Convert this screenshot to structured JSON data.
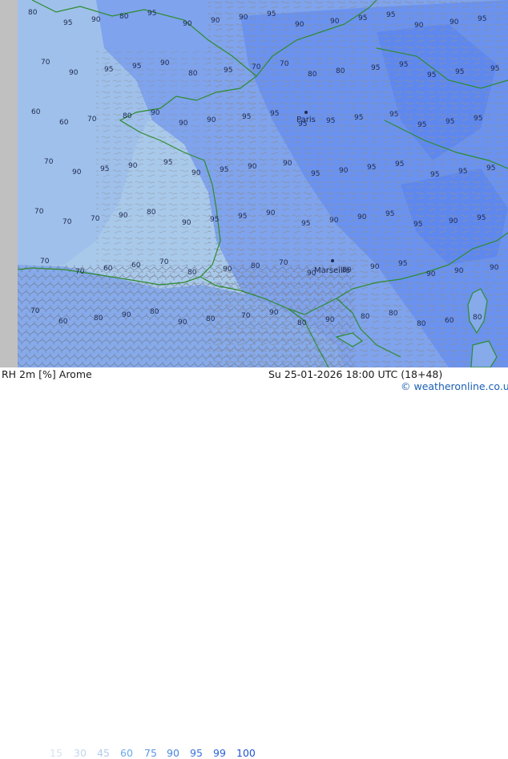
{
  "product": {
    "label": "RH 2m [%] Arome"
  },
  "run": {
    "label": "Su 25-01-2026 18:00 UTC (18+48)"
  },
  "copyright": {
    "label": "© weatheronline.co.uk"
  },
  "colors": {
    "sea_gray": "#c0c0c0",
    "rh_60": "#a9c9ea",
    "rh_75": "#96b9e8",
    "rh_90": "#7fa3ec",
    "rh_95": "#5f88ee",
    "coast": "#2e8b2e",
    "contour": "#7f7f7f"
  },
  "legend": [
    {
      "value": "15",
      "color": "#d6e2f0"
    },
    {
      "value": "30",
      "color": "#c4d6ee"
    },
    {
      "value": "45",
      "color": "#b3cbec"
    },
    {
      "value": "60",
      "color": "#6aa8e8"
    },
    {
      "value": "75",
      "color": "#5b97e3"
    },
    {
      "value": "90",
      "color": "#4a84e0"
    },
    {
      "value": "95",
      "color": "#3a72dc"
    },
    {
      "value": "99",
      "color": "#2c62d6"
    },
    {
      "value": "100",
      "color": "#1f52d0"
    }
  ],
  "cities": [
    "Paris",
    "Marseille"
  ],
  "contour_labels": [
    "80",
    "95",
    "90",
    "80",
    "95",
    "90",
    "90",
    "90",
    "95",
    "90",
    "90",
    "95",
    "95",
    "90",
    "90",
    "95",
    "70",
    "90",
    "95",
    "95",
    "90",
    "80",
    "95",
    "70",
    "70",
    "80",
    "80",
    "95",
    "95",
    "95",
    "95",
    "95",
    "60",
    "60",
    "70",
    "80",
    "90",
    "90",
    "90",
    "95",
    "95",
    "95",
    "95",
    "95",
    "95",
    "95",
    "95",
    "95",
    "70",
    "90",
    "95",
    "90",
    "95",
    "90",
    "95",
    "90",
    "90",
    "95",
    "90",
    "95",
    "95",
    "95",
    "95",
    "95",
    "70",
    "70",
    "70",
    "90",
    "80",
    "90",
    "95",
    "95",
    "90",
    "95",
    "90",
    "90",
    "95",
    "95",
    "90",
    "95",
    "70",
    "70",
    "60",
    "60",
    "70",
    "80",
    "90",
    "80",
    "70",
    "90",
    "80",
    "90",
    "95",
    "90",
    "90",
    "90",
    "70",
    "60",
    "80",
    "90",
    "80",
    "90",
    "80",
    "70",
    "90",
    "80",
    "90",
    "80",
    "80",
    "80",
    "60",
    "80"
  ]
}
